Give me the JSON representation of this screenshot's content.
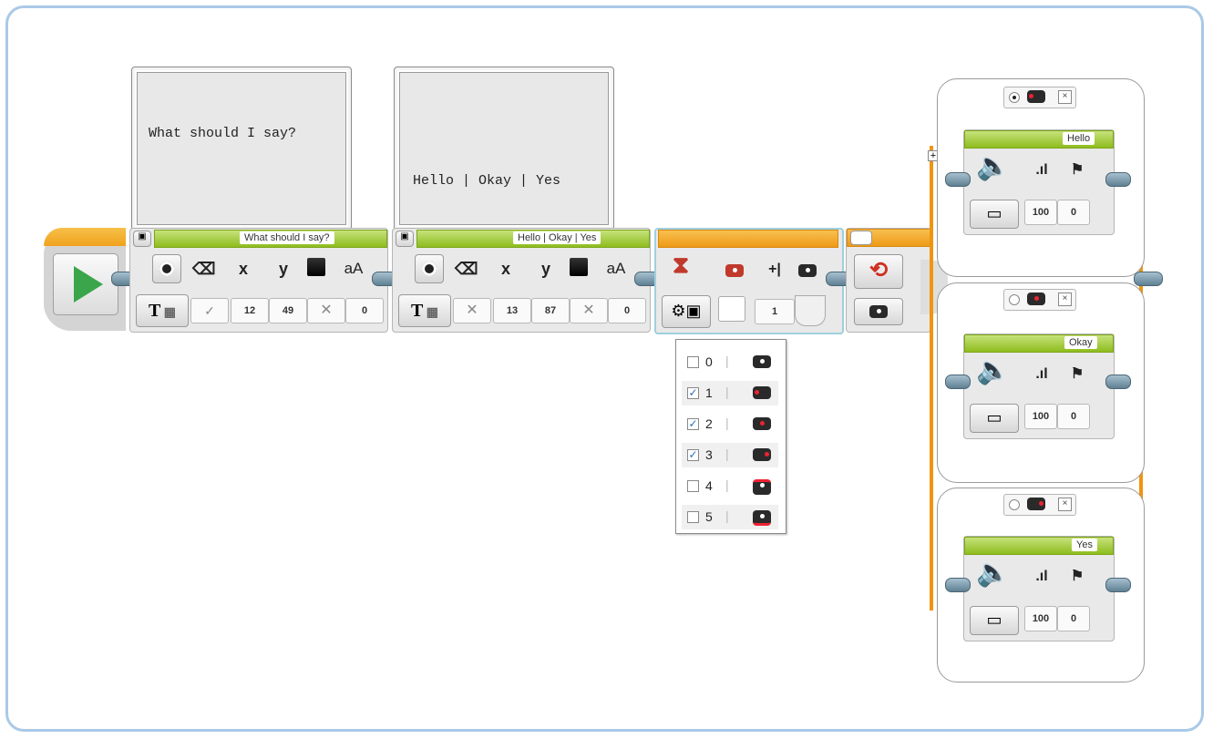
{
  "display1": {
    "screen_text": "What should I say?",
    "title": "What should I say?",
    "values": {
      "clear": "✓",
      "x": "12",
      "y": "49",
      "color": "✕",
      "font": "0"
    }
  },
  "display2": {
    "screen_text": "Hello | Okay | Yes",
    "title": "Hello | Okay | Yes",
    "values": {
      "clear": "✕",
      "x": "13",
      "y": "87",
      "color": "✕",
      "font": "0"
    }
  },
  "wait": {
    "value": "1"
  },
  "dropdown": {
    "items": [
      {
        "label": "0",
        "checked": false
      },
      {
        "label": "1",
        "checked": true
      },
      {
        "label": "2",
        "checked": true
      },
      {
        "label": "3",
        "checked": true
      },
      {
        "label": "4",
        "checked": false
      },
      {
        "label": "5",
        "checked": false
      }
    ]
  },
  "cases": [
    {
      "label": "Hello",
      "volume": "100",
      "play_type": "0",
      "selected": true
    },
    {
      "label": "Okay",
      "volume": "100",
      "play_type": "0",
      "selected": false
    },
    {
      "label": "Yes",
      "volume": "100",
      "play_type": "0",
      "selected": false
    }
  ],
  "icons": {
    "start": "play-icon",
    "display_mode": "text-grid-icon",
    "wait": "hourglass-icon",
    "loop": "loop-icon",
    "sound": "speaker-icon",
    "file": "folder-icon"
  },
  "colors": {
    "green_bar": "#8ebd1e",
    "orange_bar": "#ee9a17",
    "play": "#3aa54a",
    "frame": "#a9c9e6"
  }
}
